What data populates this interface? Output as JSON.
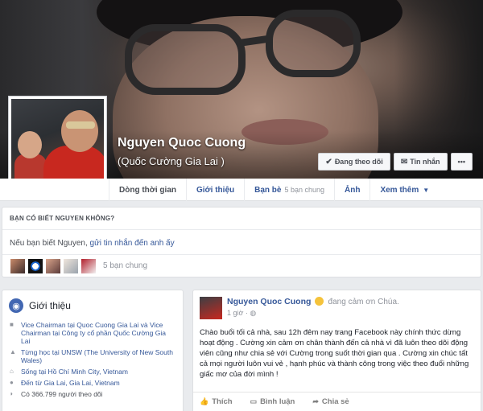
{
  "profile": {
    "name": "Nguyen Quoc Cuong",
    "alt_name": "(Quốc Cường Gia Lai )"
  },
  "cover_actions": {
    "following": "Đang theo dõi",
    "message": "Tin nhắn",
    "more": "•••"
  },
  "tabs": [
    {
      "label": "Dòng thời gian"
    },
    {
      "label": "Giới thiệu"
    },
    {
      "label": "Bạn bè",
      "sub": "5 bạn chung"
    },
    {
      "label": "Ảnh"
    },
    {
      "label": "Xem thêm"
    }
  ],
  "know_card": {
    "heading": "BẠN CÓ BIẾT NGUYEN KHÔNG?",
    "text_pre": "Nếu bạn biết Nguyen, ",
    "link": "gửi tin nhắn đến anh ấy",
    "mutual": "5 bạn chung"
  },
  "intro": {
    "title": "Giới thiệu",
    "items": [
      {
        "icon": "briefcase-icon",
        "text": "Vice Chairman tại Quoc Cuong Gia Lai và Vice Chairman tại Công ty cổ phần Quốc Cường Gia Lai"
      },
      {
        "icon": "graduation-icon",
        "text": "Từng học tại UNSW (The University of New South Wales)"
      },
      {
        "icon": "home-icon",
        "text": "Sống tại Hồ Chí Minh City, Vietnam"
      },
      {
        "icon": "pin-icon",
        "text": "Đến từ Gia Lai, Gia Lai, Vietnam"
      },
      {
        "icon": "rss-icon",
        "text": "Có 366.799 người theo dõi"
      }
    ]
  },
  "post": {
    "author": "Nguyen Quoc Cuong",
    "feeling": "đang cảm ơn Chúa.",
    "time": "1 giờ · ",
    "body": "Chào buổi tối cả nhà, sau 12h đêm nay trang Facebook này chính thức dừng hoạt động . Cường xin cảm ơn chân thành đến cả nhà vì đã luôn theo dõi động viên cũng như chia sẻ với Cường trong suốt thời gian qua . Cường xin chúc tất cả mọi người luôn vui vẻ , hạnh phúc và thành công trong việc theo đuổi những giấc mơ của đời mình !",
    "actions": {
      "like": "Thích",
      "comment": "Bình luận",
      "share": "Chia sẻ"
    }
  }
}
